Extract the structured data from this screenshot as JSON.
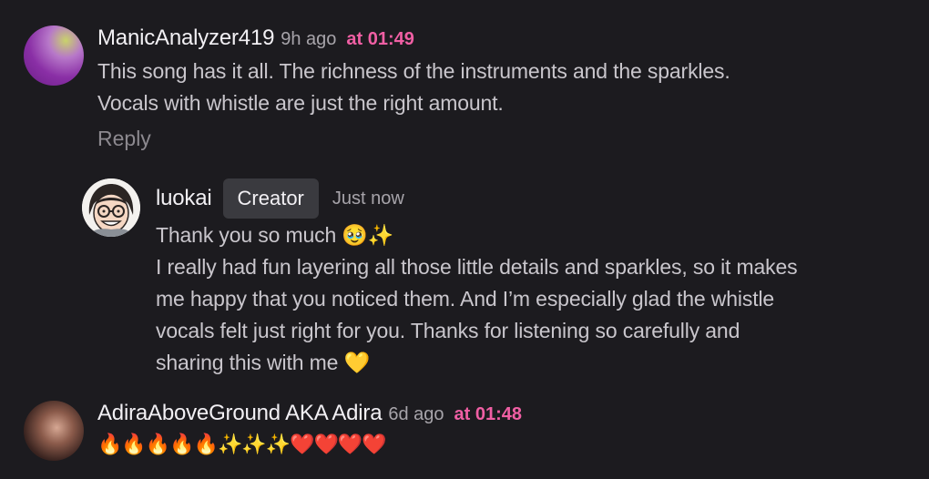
{
  "comments": [
    {
      "username": "ManicAnalyzer419",
      "time_ago": "9h ago",
      "timestamp": "at 01:49",
      "lines": [
        "This song has it all. The richness of the instruments and the sparkles.",
        "Vocals with whistle are just the right amount."
      ],
      "reply_label": "Reply"
    },
    {
      "username": "luokai",
      "badge": "Creator",
      "time_ago": "Just now",
      "lines": [
        "Thank you so much 🥹✨",
        "I really had fun layering all those little details and sparkles, so it makes",
        "me happy that you noticed them. And I’m especially glad the whistle",
        "vocals felt just right for you. Thanks for listening so carefully and",
        "sharing this with me 💛"
      ]
    },
    {
      "username": "AdiraAboveGround AKA Adira",
      "time_ago": "6d ago",
      "timestamp": "at 01:48",
      "lines": [
        "🔥🔥🔥🔥🔥✨✨✨❤️❤️❤️❤️"
      ]
    }
  ],
  "colors": {
    "background": "#1c1b1f",
    "timestamp_accent": "#f05fa4",
    "badge_bg": "#3a3a3f"
  },
  "icons": {
    "c1_avatar": "purple-gradient-avatar",
    "c2_avatar": "cartoon-face-avatar",
    "c3_avatar": "photo-avatar"
  }
}
